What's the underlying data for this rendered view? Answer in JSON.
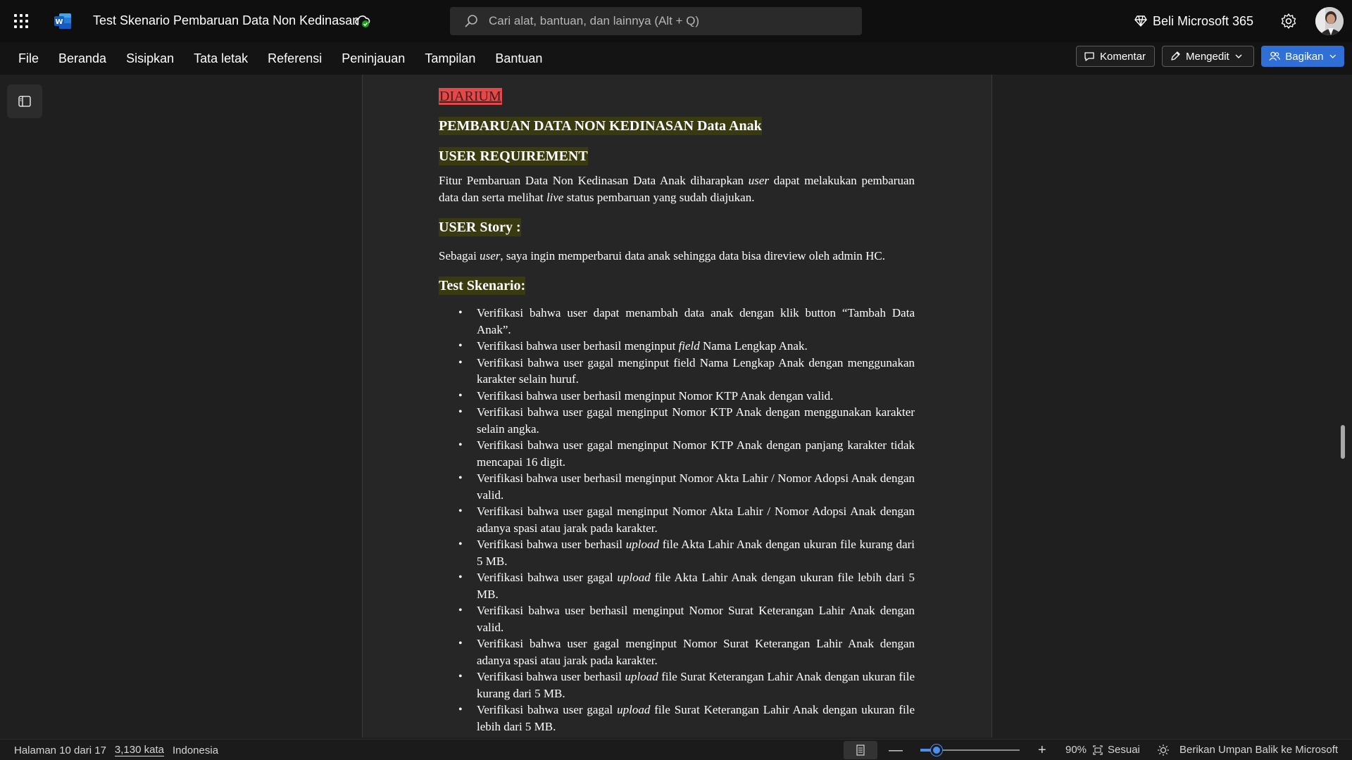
{
  "titlebar": {
    "app_icon": "word-icon",
    "doc_title": "Test Skenario Pembaruan Data Non Kedinasan",
    "search_placeholder": "Cari alat, bantuan, dan lainnya (Alt + Q)",
    "buy_label": "Beli Microsoft 365"
  },
  "menu": {
    "items": [
      "File",
      "Beranda",
      "Sisipkan",
      "Tata letak",
      "Referensi",
      "Peninjauan",
      "Tampilan",
      "Bantuan"
    ],
    "comment_label": "Komentar",
    "edit_label": "Mengedit",
    "share_label": "Bagikan"
  },
  "document": {
    "heading_diarium": "DIARIUM",
    "heading_main": "PEMBARUAN DATA NON KEDINASAN Data Anak",
    "heading_requirement": "USER REQUIREMENT",
    "requirement_parts": [
      "Fitur Pembaruan Data Non Kedinasan Data Anak diharapkan ",
      "user",
      " dapat melakukan pembaruan data dan serta melihat ",
      "live",
      " status pembaruan yang sudah diajukan."
    ],
    "heading_story": "USER Story :",
    "story_parts": [
      "Sebagai ",
      "user",
      ", saya ingin memperbarui data anak sehingga data bisa direview oleh admin HC."
    ],
    "heading_scenario": "Test Skenario:",
    "scenarios": [
      [
        "Verifikasi bahwa user dapat menambah data anak dengan klik button “Tambah Data Anak”."
      ],
      [
        "Verifikasi bahwa user berhasil menginput ",
        "field",
        " Nama Lengkap Anak."
      ],
      [
        "Verifikasi bahwa user gagal menginput field Nama Lengkap Anak dengan menggunakan karakter selain huruf."
      ],
      [
        "Verifikasi bahwa user berhasil menginput Nomor KTP Anak dengan valid."
      ],
      [
        "Verifikasi bahwa user gagal menginput Nomor KTP Anak dengan menggunakan karakter selain angka."
      ],
      [
        "Verifikasi bahwa user gagal menginput Nomor KTP Anak dengan panjang karakter tidak mencapai 16 digit."
      ],
      [
        "Verifikasi bahwa user berhasil menginput Nomor Akta Lahir / Nomor Adopsi Anak dengan valid."
      ],
      [
        "Verifikasi bahwa user gagal menginput Nomor Akta Lahir / Nomor Adopsi Anak dengan adanya spasi atau jarak pada karakter."
      ],
      [
        "Verifikasi bahwa user berhasil ",
        "upload",
        " file Akta Lahir Anak dengan ukuran file kurang dari 5 MB."
      ],
      [
        "Verifikasi bahwa user gagal ",
        "upload",
        " file Akta Lahir Anak dengan ukuran file lebih dari 5 MB."
      ],
      [
        "Verifikasi bahwa user berhasil menginput Nomor Surat Keterangan Lahir Anak dengan valid."
      ],
      [
        "Verifikasi bahwa user gagal menginput Nomor Surat Keterangan Lahir Anak dengan adanya spasi atau jarak pada karakter."
      ],
      [
        "Verifikasi bahwa user berhasil ",
        "upload",
        " file Surat Keterangan Lahir Anak dengan ukuran file kurang dari 5 MB."
      ],
      [
        "Verifikasi bahwa user gagal ",
        "upload",
        " file Surat Keterangan Lahir Anak dengan ukuran file lebih dari 5 MB."
      ]
    ]
  },
  "status": {
    "page": "Halaman 10 dari 17",
    "words": "3,130 kata",
    "language": "Indonesia",
    "zoom_pct": "90%",
    "zoom_level": 0.16,
    "fit_label": "Sesuai",
    "feedback_label": "Berikan Umpan Balik ke Microsoft"
  },
  "colors": {
    "accent": "#2f6fd6",
    "diarium_highlight": "#e54848",
    "heading_highlight": "#3a3a10"
  }
}
